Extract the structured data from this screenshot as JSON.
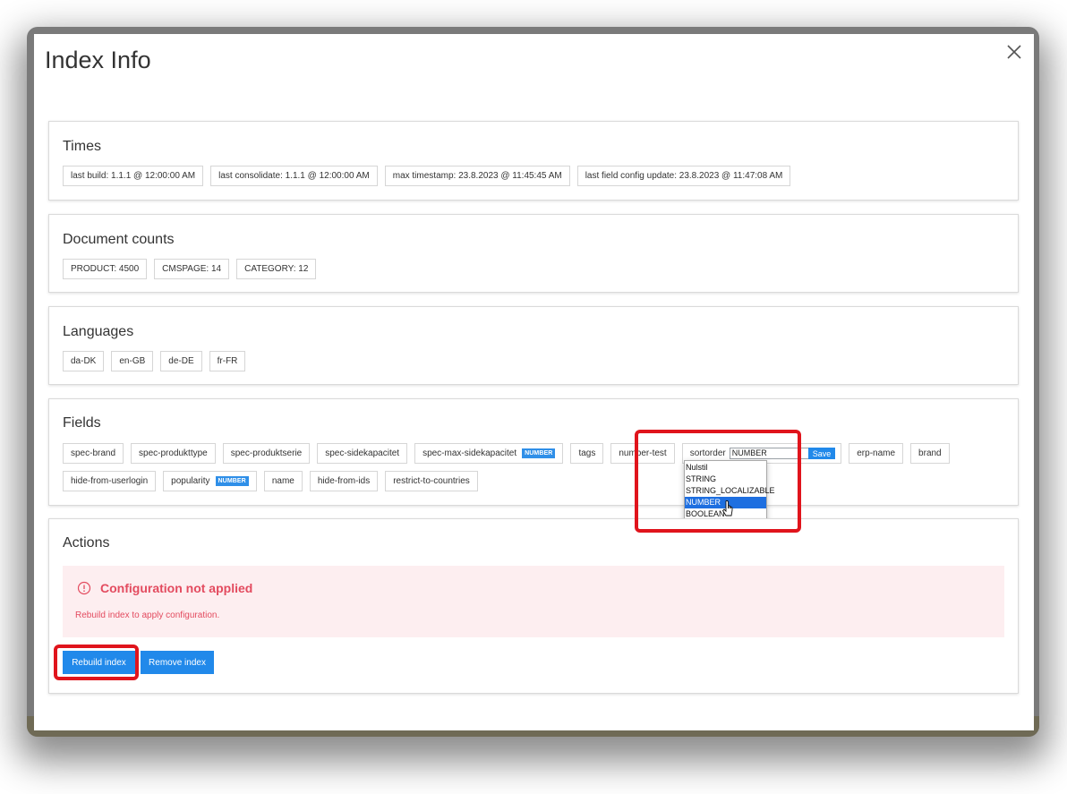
{
  "modal": {
    "title": "Index Info"
  },
  "times": {
    "heading": "Times",
    "chips": [
      "last build: 1.1.1 @ 12:00:00 AM",
      "last consolidate: 1.1.1 @ 12:00:00 AM",
      "max timestamp: 23.8.2023 @ 11:45:45 AM",
      "last field config update: 23.8.2023 @ 11:47:08 AM"
    ]
  },
  "document_counts": {
    "heading": "Document counts",
    "chips": [
      "PRODUCT: 4500",
      "CMSPAGE: 14",
      "CATEGORY: 12"
    ]
  },
  "languages": {
    "heading": "Languages",
    "chips": [
      "da-DK",
      "en-GB",
      "de-DE",
      "fr-FR"
    ]
  },
  "fields": {
    "heading": "Fields",
    "items": [
      {
        "name": "spec-brand",
        "badge": ""
      },
      {
        "name": "spec-produkttype",
        "badge": ""
      },
      {
        "name": "spec-produktserie",
        "badge": ""
      },
      {
        "name": "spec-sidekapacitet",
        "badge": ""
      },
      {
        "name": "spec-max-sidekapacitet",
        "badge": "NUMBER"
      },
      {
        "name": "tags",
        "badge": ""
      },
      {
        "name": "number-test",
        "badge": ""
      },
      {
        "name": "sortorder",
        "editing": true
      },
      {
        "name": "erp-name",
        "badge": ""
      },
      {
        "name": "brand",
        "badge": ""
      },
      {
        "name": "hide-from-userlogin",
        "badge": ""
      },
      {
        "name": "popularity",
        "badge": "NUMBER"
      },
      {
        "name": "name",
        "badge": ""
      },
      {
        "name": "hide-from-ids",
        "badge": ""
      },
      {
        "name": "restrict-to-countries",
        "badge": ""
      }
    ],
    "editor": {
      "field": "sortorder",
      "value": "NUMBER",
      "save_label": "Save",
      "options": [
        "Nulstil",
        "STRING",
        "STRING_LOCALIZABLE",
        "NUMBER",
        "BOOLEAN"
      ],
      "selected": "NUMBER"
    }
  },
  "actions": {
    "heading": "Actions",
    "alert_title": "Configuration not applied",
    "alert_text": "Rebuild index to apply configuration.",
    "rebuild_label": "Rebuild index",
    "remove_label": "Remove index"
  },
  "colors": {
    "primary": "#2189ea",
    "alert_bg": "#fdeef0",
    "alert_text": "#e34b5f",
    "highlight": "#e0141c"
  }
}
